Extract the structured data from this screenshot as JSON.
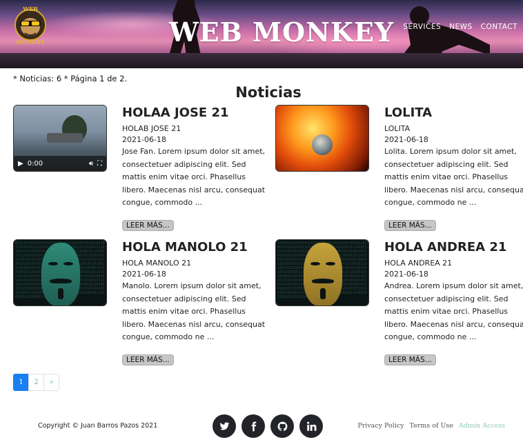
{
  "header": {
    "logo_text": "WEB MONKEY",
    "title": "WEB MONKEY",
    "nav": [
      "SERVICES",
      "NEWS",
      "CONTACT"
    ]
  },
  "info_line": "* Noticias: 6 * Página 1 de 2.",
  "section_title": "Noticias",
  "articles": [
    {
      "title": "HOLAA JOSE 21",
      "subtitle": "HOLAB JOSE 21",
      "date": "2021-06-18",
      "excerpt": "Jose Fan. Lorem ipsum dolor sit amet, consectetuer adipiscing elit. Sed mattis enim vitae orci. Phasellus libero. Maecenas nisl arcu, consequat congue, commodo ...",
      "button": "LEER MÁS...",
      "media_time": "0:00"
    },
    {
      "title": "LOLITA",
      "subtitle": "LOLITA",
      "date": "2021-06-18",
      "excerpt": "Lolita. Lorem ipsum dolor sit amet, consectetuer adipiscing elit. Sed mattis enim vitae orci. Phasellus libero. Maecenas nisl arcu, consequat congue, commodo ne ...",
      "button": "LEER MÁS..."
    },
    {
      "title": "HOLA MANOLO 21",
      "subtitle": "HOLA MANOLO 21",
      "date": "2021-06-18",
      "excerpt": "Manolo. Lorem ipsum dolor sit amet, consectetuer adipiscing elit. Sed mattis enim vitae orci. Phasellus libero. Maecenas nisl arcu, consequat congue, commodo ne ...",
      "button": "LEER MÁS..."
    },
    {
      "title": "HOLA ANDREA 21",
      "subtitle": "HOLA ANDREA 21",
      "date": "2021-06-18",
      "excerpt": "Andrea. Lorem ipsum dolor sit amet, consectetuer adipiscing elit. Sed mattis enim vitae orci. Phasellus libero. Maecenas nisl arcu, consequat congue, commodo ne ...",
      "button": "LEER MÁS..."
    }
  ],
  "pagination": {
    "pages": [
      "1",
      "2"
    ],
    "next": "»",
    "active": "1"
  },
  "footer": {
    "copyright": "Copyright © Juan Barros Pazos 2021",
    "socials": [
      "twitter-icon",
      "facebook-icon",
      "github-icon",
      "linkedin-icon"
    ],
    "links": [
      "Privacy Policy",
      "Terms of Use",
      "Admin Access"
    ]
  },
  "colors": {
    "pagination_active": "#1a7ff0",
    "social_bg": "#222429",
    "admin_link": "#8cc9b4",
    "button_bg": "#c6c6c6"
  }
}
